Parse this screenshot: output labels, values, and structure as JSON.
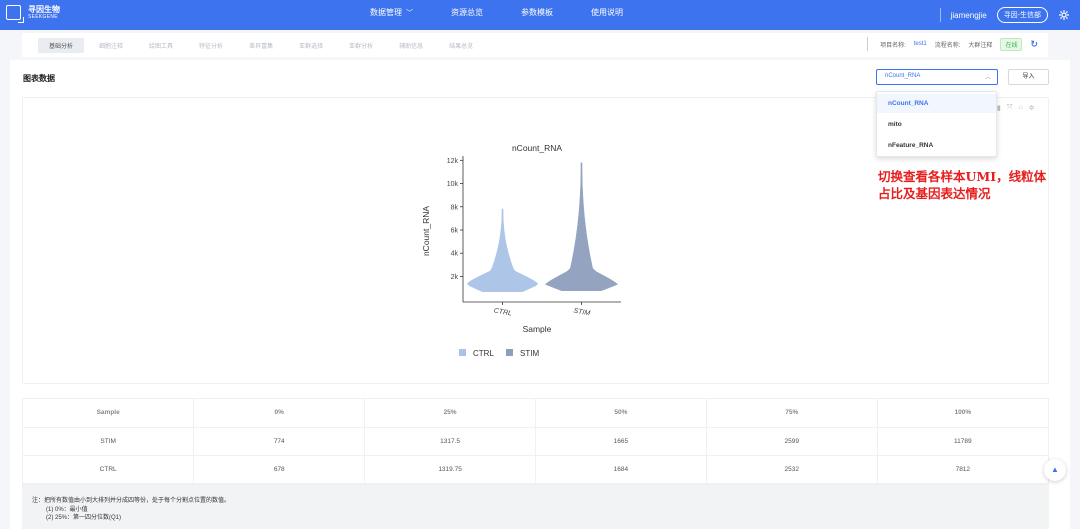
{
  "brand": {
    "cn": "寻因生物",
    "en": "SEEKGENE"
  },
  "nav": {
    "items": [
      {
        "label": "数据管理",
        "has_dropdown": true
      },
      {
        "label": "资源总览",
        "has_dropdown": false
      },
      {
        "label": "参数模板",
        "has_dropdown": false
      },
      {
        "label": "使用说明",
        "has_dropdown": false
      }
    ],
    "user": "jiamengjie",
    "company": "寻因-生信部"
  },
  "subnav": {
    "tabs": [
      "基础分析",
      "细胞注释",
      "绘图工具",
      "特征分析",
      "差异富集",
      "亚群选择",
      "亚群分析",
      "辅助信息",
      "结果总览"
    ],
    "active_index": 0,
    "project_label": "项目名称:",
    "project_value": "test1",
    "workflow_label": "流程名称:",
    "workflow_value": "大群注释",
    "status": "在线"
  },
  "panel": {
    "title": "图表数据",
    "select_value": "nCount_RNA",
    "import_label": "导入"
  },
  "dropdown": {
    "options": [
      "nCount_RNA",
      "mito",
      "nFeature_RNA"
    ],
    "selected_index": 0
  },
  "annotation": {
    "line1": "切换查看各样本UMI，线粒体",
    "line2": "占比及基因表达情况"
  },
  "chart_data": {
    "type": "violin",
    "title": "nCount_RNA",
    "xlabel": "Sample",
    "ylabel": "nCount_RNA",
    "categories": [
      "CTRL",
      "STIM"
    ],
    "y_ticks": [
      2000,
      4000,
      6000,
      8000,
      10000,
      12000
    ],
    "y_tick_labels": [
      "2k",
      "4k",
      "6k",
      "8k",
      "10k",
      "12k"
    ],
    "ylim": [
      -200,
      12200
    ],
    "legend": [
      {
        "name": "CTRL",
        "color": "#a9c2e6"
      },
      {
        "name": "STIM",
        "color": "#8e9fbd"
      }
    ],
    "series": [
      {
        "name": "CTRL",
        "min": 678,
        "q1": 1319.75,
        "median": 1684,
        "q3": 2532,
        "max": 7812
      },
      {
        "name": "STIM",
        "min": 774,
        "q1": 1317.5,
        "median": 1665,
        "q3": 2599,
        "max": 11789
      }
    ]
  },
  "table": {
    "headers": [
      "Sample",
      "0%",
      "25%",
      "50%",
      "75%",
      "100%"
    ],
    "rows": [
      [
        "STIM",
        "774",
        "1317.5",
        "1665",
        "2599",
        "11789"
      ],
      [
        "CTRL",
        "678",
        "1319.75",
        "1684",
        "2532",
        "7812"
      ]
    ]
  },
  "note": {
    "line1": "注：把所有数值由小到大排列并分成四等份，处于每个分割点位置的数值。",
    "line2": "(1) 0%：最小值",
    "line3": "(2) 25%：第一四分位数(Q1)"
  }
}
